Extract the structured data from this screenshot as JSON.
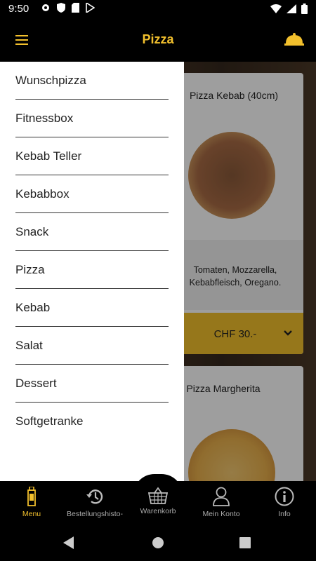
{
  "status_bar": {
    "time": "9:50"
  },
  "app_bar": {
    "title": "Pizza"
  },
  "products": [
    {
      "title": "Pizza Kebab (40cm)",
      "description_line1": "Tomaten, Mozzarella,",
      "description_line2": "Kebabfleisch, Oregano.",
      "price": "CHF 30.-"
    },
    {
      "title": "Pizza Margherita"
    }
  ],
  "drawer": {
    "items": [
      {
        "label": "Wunschpizza"
      },
      {
        "label": "Fitnessbox"
      },
      {
        "label": "Kebab Teller"
      },
      {
        "label": "Kebabbox"
      },
      {
        "label": "Snack"
      },
      {
        "label": "Pizza"
      },
      {
        "label": "Kebab"
      },
      {
        "label": "Salat"
      },
      {
        "label": "Dessert"
      },
      {
        "label": "Softgetranke"
      }
    ]
  },
  "bottom_nav": {
    "items": [
      {
        "label": "Menu",
        "icon": "bottle-icon",
        "active": true
      },
      {
        "label": "Bestellungshisto-",
        "icon": "history-icon"
      },
      {
        "label": "Warenkorb",
        "icon": "basket-icon"
      },
      {
        "label": "Mein Konto",
        "icon": "person-icon"
      },
      {
        "label": "Info",
        "icon": "info-icon"
      }
    ]
  },
  "colors": {
    "accent": "#f2c02d",
    "bar": "#000000",
    "drawer": "#ffffff"
  }
}
